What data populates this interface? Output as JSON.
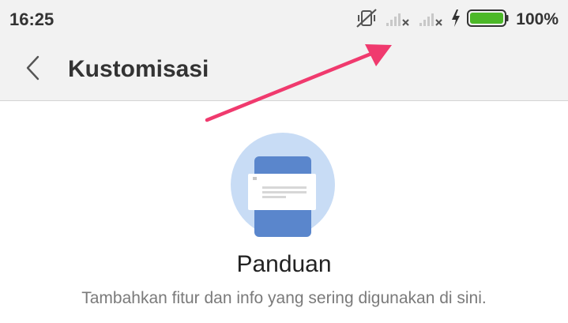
{
  "status_bar": {
    "time": "16:25",
    "battery_percent": "100%",
    "icons": [
      "vibrate-off-icon",
      "signal-none-icon",
      "signal-none-icon",
      "charging-bolt-icon",
      "battery-full-icon"
    ],
    "battery_level": 1.0,
    "battery_color": "#4cb828"
  },
  "toolbar": {
    "back_icon": "chevron-left-icon",
    "title": "Kustomisasi"
  },
  "guide": {
    "illustration_icon": "guide-card-illustration",
    "title": "Panduan",
    "description": "Tambahkan fitur dan info yang sering digunakan di sini."
  },
  "annotation": {
    "arrow_color": "#f03a6e"
  }
}
